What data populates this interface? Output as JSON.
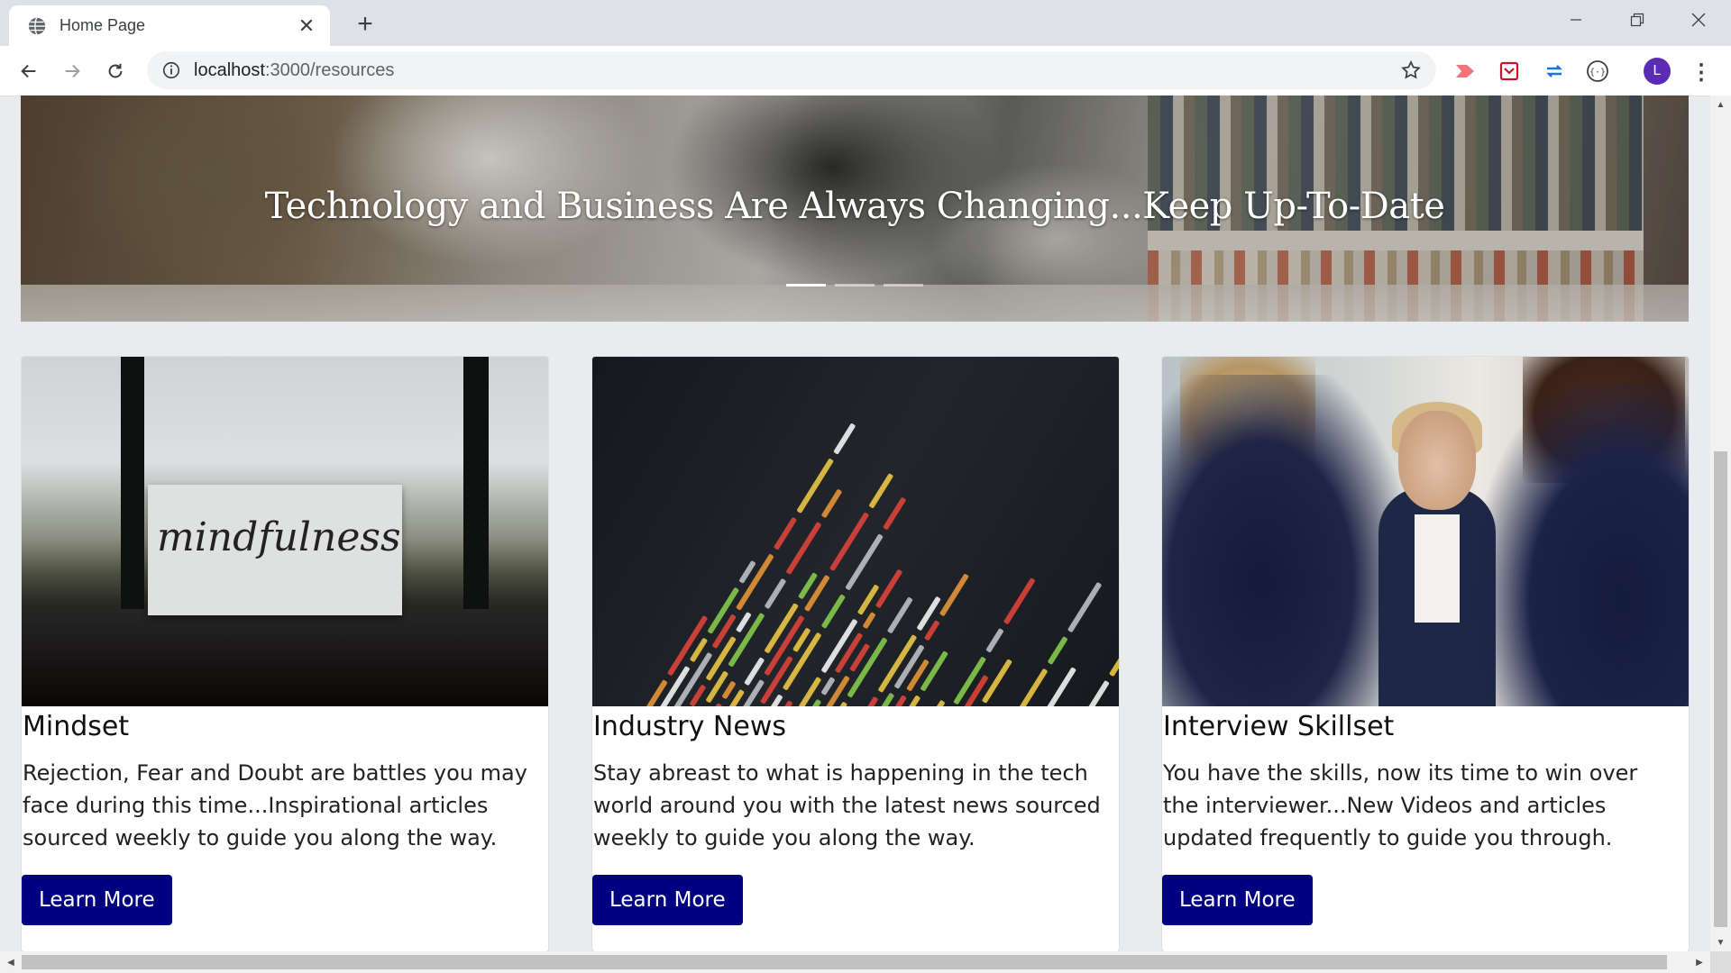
{
  "browser": {
    "tab_title": "Home Page",
    "new_tab_symbol": "+",
    "url_host": "localhost",
    "url_path": ":3000/resources",
    "profile_initial": "L",
    "accent": "#5b2bb5"
  },
  "hero": {
    "caption": "Technology and Business Are Always Changing...Keep Up-To-Date",
    "slides": 3,
    "active_slide": 1
  },
  "cards": [
    {
      "title": "Mindset",
      "text": "Rejection, Fear and Doubt are battles you may face during this time...Inspirational articles sourced weekly to guide you along the way.",
      "button": "Learn More",
      "image_word": "mindfulness"
    },
    {
      "title": "Industry News",
      "text": "Stay abreast to what is happening in the tech world around you with the latest news sourced weekly to guide you along the way.",
      "button": "Learn More"
    },
    {
      "title": "Interview Skillset",
      "text": "You have the skills, now its time to win over the interviewer...New Videos and articles updated frequently to guide you through.",
      "button": "Learn More"
    }
  ],
  "colors": {
    "button_bg": "#000080",
    "page_bg": "#e9ebee"
  }
}
